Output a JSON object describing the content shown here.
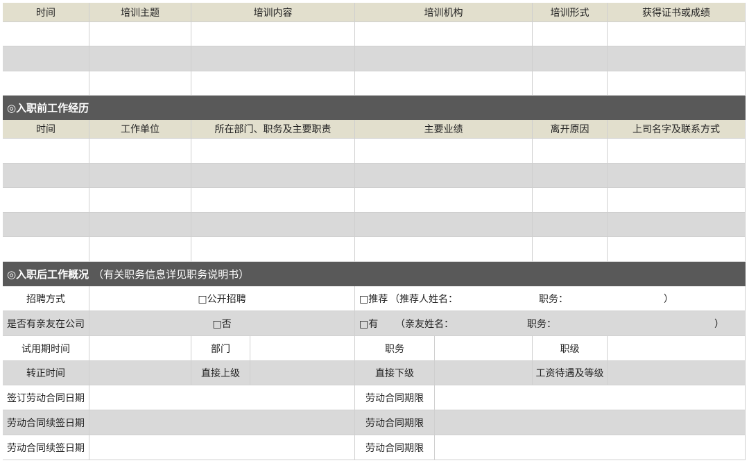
{
  "training": {
    "headers": [
      "时间",
      "培训主题",
      "培训内容",
      "培训机构",
      "培训形式",
      "获得证书或成绩"
    ]
  },
  "prior_work": {
    "title": "◎入职前工作经历",
    "headers": [
      "时间",
      "工作单位",
      "所在部门、职务及主要职责",
      "主要业绩",
      "离开原因",
      "上司名字及联系方式"
    ]
  },
  "post_entry": {
    "title": "◎入职后工作概况",
    "note": "（有关职务信息详见职务说明书）",
    "recruit_label": "招聘方式",
    "recruit_public": "□公开招聘",
    "recruit_referral": "□推荐",
    "referrer_name": "（推荐人姓名：",
    "referrer_position": "职务：",
    "close_paren": "）",
    "relatives_label": "是否有亲友在公司",
    "relatives_no": "□否",
    "relatives_yes": "□有",
    "relative_name": "（亲友姓名：",
    "relative_position": "职务：",
    "probation_label": "试用期时间",
    "department_label": "部门",
    "position_label": "职务",
    "rank_label": "职级",
    "regularization_label": "转正时间",
    "supervisor_label": "直接上级",
    "subordinate_label": "直接下级",
    "salary_label": "工资待遇及等级",
    "contract_sign_label": "签订劳动合同日期",
    "contract_term_label": "劳动合同期限",
    "renewal_label_1": "劳动合同续签日期",
    "renewal_term_label_1": "劳动合同期限",
    "renewal_label_2": "劳动合同续签日期",
    "renewal_term_label_2": "劳动合同期限"
  }
}
